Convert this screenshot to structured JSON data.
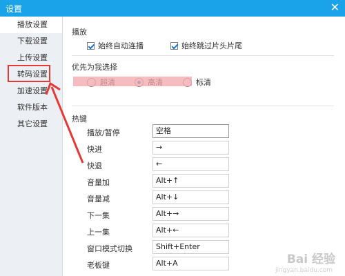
{
  "window": {
    "title": "设置",
    "close_glyph": "✕"
  },
  "sidebar": {
    "items": [
      {
        "label": "播放设置"
      },
      {
        "label": "下载设置"
      },
      {
        "label": "上传设置"
      },
      {
        "label": "转码设置"
      },
      {
        "label": "加速设置"
      },
      {
        "label": "软件版本"
      },
      {
        "label": "其它设置"
      }
    ]
  },
  "playback": {
    "title": "播放",
    "option1": "始终自动连播",
    "option2": "始终跳过片头片尾"
  },
  "quality": {
    "title": "优先为我选择",
    "options": [
      {
        "label": "超清",
        "selected": false
      },
      {
        "label": "高清",
        "selected": true
      },
      {
        "label": "标清",
        "selected": false
      }
    ]
  },
  "hotkeys": {
    "title": "热键",
    "items": [
      {
        "label": "播放/暂停",
        "value": "空格"
      },
      {
        "label": "快进",
        "value": "→"
      },
      {
        "label": "快退",
        "value": "←"
      },
      {
        "label": "音量加",
        "value": "Alt+↑"
      },
      {
        "label": "音量减",
        "value": "Alt+↓"
      },
      {
        "label": "下一集",
        "value": "Alt+→"
      },
      {
        "label": "上一集",
        "value": "Alt+←"
      },
      {
        "label": "窗口模式切换",
        "value": "Shift+Enter"
      },
      {
        "label": "老板键",
        "value": "Alt+A"
      }
    ]
  },
  "watermark": {
    "logo": "Bai 经验",
    "url": "jingyan.baidu.com"
  },
  "colors": {
    "titlebar": "#1aa3e8",
    "sidebar_bg": "#eceff3",
    "highlight": "#e53935"
  }
}
